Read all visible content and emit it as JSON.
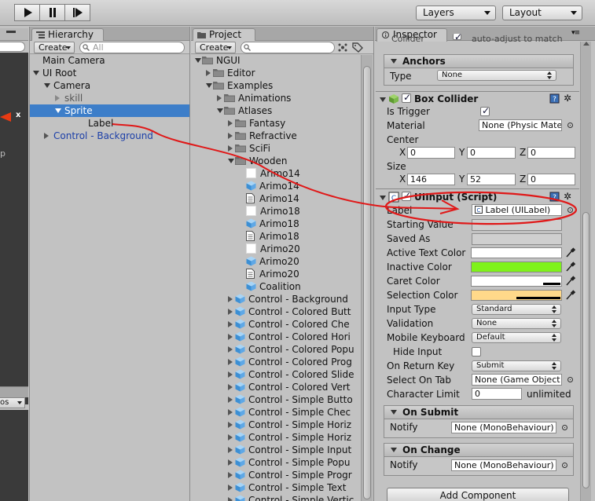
{
  "toolbar": {
    "play": "play-icon",
    "pause": "pause-icon",
    "step": "step-icon",
    "layers": "Layers",
    "layout": "Layout"
  },
  "scene_fragments": {
    "axis_x": "x",
    "side_letter": "p",
    "gizmos": "os"
  },
  "hierarchy": {
    "tab": "Hierarchy",
    "create": "Create",
    "search_placeholder": "All",
    "items": [
      {
        "label": "Main Camera",
        "indent": 0,
        "fold": "none"
      },
      {
        "label": "UI Root",
        "indent": 0,
        "fold": "down"
      },
      {
        "label": "Camera",
        "indent": 1,
        "fold": "down"
      },
      {
        "label": "skill",
        "indent": 2,
        "fold": "right-gray"
      },
      {
        "label": "Sprite",
        "indent": 2,
        "fold": "down",
        "selected": true
      },
      {
        "label": "Label",
        "indent": 3,
        "fold": "none"
      },
      {
        "label": "Control - Background",
        "indent": 1,
        "fold": "right",
        "link": true
      }
    ]
  },
  "project": {
    "tab": "Project",
    "create": "Create",
    "items": [
      {
        "label": "NGUI",
        "icon": "folder",
        "indent": 0,
        "fold": "down"
      },
      {
        "label": "Editor",
        "icon": "folder",
        "indent": 1,
        "fold": "right"
      },
      {
        "label": "Examples",
        "icon": "folder",
        "indent": 1,
        "fold": "down"
      },
      {
        "label": "Animations",
        "icon": "folder",
        "indent": 2,
        "fold": "right"
      },
      {
        "label": "Atlases",
        "icon": "folder",
        "indent": 2,
        "fold": "down"
      },
      {
        "label": "Fantasy",
        "icon": "folder",
        "indent": 3,
        "fold": "right"
      },
      {
        "label": "Refractive",
        "icon": "folder",
        "indent": 3,
        "fold": "right"
      },
      {
        "label": "SciFi",
        "icon": "folder",
        "indent": 3,
        "fold": "right"
      },
      {
        "label": "Wooden",
        "icon": "folder",
        "indent": 3,
        "fold": "down"
      },
      {
        "label": "Arimo14",
        "icon": "white",
        "indent": 4,
        "fold": "none"
      },
      {
        "label": "Arimo14",
        "icon": "cube",
        "indent": 4,
        "fold": "none"
      },
      {
        "label": "Arimo14",
        "icon": "doc",
        "indent": 4,
        "fold": "none"
      },
      {
        "label": "Arimo18",
        "icon": "white",
        "indent": 4,
        "fold": "none"
      },
      {
        "label": "Arimo18",
        "icon": "cube",
        "indent": 4,
        "fold": "none"
      },
      {
        "label": "Arimo18",
        "icon": "doc",
        "indent": 4,
        "fold": "none"
      },
      {
        "label": "Arimo20",
        "icon": "white",
        "indent": 4,
        "fold": "none"
      },
      {
        "label": "Arimo20",
        "icon": "cube",
        "indent": 4,
        "fold": "none"
      },
      {
        "label": "Arimo20",
        "icon": "doc",
        "indent": 4,
        "fold": "none"
      },
      {
        "label": "Coalition",
        "icon": "cube",
        "indent": 4,
        "fold": "none"
      },
      {
        "label": "Control - Background",
        "icon": "cube",
        "indent": 3,
        "fold": "right"
      },
      {
        "label": "Control - Colored Butt",
        "icon": "cube",
        "indent": 3,
        "fold": "right"
      },
      {
        "label": "Control - Colored Che",
        "icon": "cube",
        "indent": 3,
        "fold": "right"
      },
      {
        "label": "Control - Colored Hori",
        "icon": "cube",
        "indent": 3,
        "fold": "right"
      },
      {
        "label": "Control - Colored Popu",
        "icon": "cube",
        "indent": 3,
        "fold": "right"
      },
      {
        "label": "Control - Colored Prog",
        "icon": "cube",
        "indent": 3,
        "fold": "right"
      },
      {
        "label": "Control - Colored Slide",
        "icon": "cube",
        "indent": 3,
        "fold": "right"
      },
      {
        "label": "Control - Colored Vert",
        "icon": "cube",
        "indent": 3,
        "fold": "right"
      },
      {
        "label": "Control - Simple Butto",
        "icon": "cube",
        "indent": 3,
        "fold": "right"
      },
      {
        "label": "Control - Simple Chec",
        "icon": "cube",
        "indent": 3,
        "fold": "right"
      },
      {
        "label": "Control - Simple Horiz",
        "icon": "cube",
        "indent": 3,
        "fold": "right"
      },
      {
        "label": "Control - Simple Horiz",
        "icon": "cube",
        "indent": 3,
        "fold": "right"
      },
      {
        "label": "Control - Simple Input",
        "icon": "cube",
        "indent": 3,
        "fold": "right"
      },
      {
        "label": "Control - Simple Popu",
        "icon": "cube",
        "indent": 3,
        "fold": "right"
      },
      {
        "label": "Control - Simple Progr",
        "icon": "cube",
        "indent": 3,
        "fold": "right"
      },
      {
        "label": "Control - Simple Text",
        "icon": "cube",
        "indent": 3,
        "fold": "right"
      },
      {
        "label": "Control - Simple Vertic",
        "icon": "cube",
        "indent": 3,
        "fold": "right"
      }
    ]
  },
  "inspector": {
    "tab": "Inspector",
    "top_partial": {
      "label": "Collider",
      "value": "auto-adjust to match"
    },
    "anchors": {
      "title": "Anchors",
      "type_label": "Type",
      "type_value": "None"
    },
    "box_collider": {
      "title": "Box Collider",
      "is_trigger_label": "Is Trigger",
      "material_label": "Material",
      "material_value": "None (Physic Mate",
      "center_label": "Center",
      "center": {
        "x": "0",
        "y": "0",
        "z": "0"
      },
      "size_label": "Size",
      "size": {
        "x": "146",
        "y": "52",
        "z": "0"
      },
      "axes": {
        "x": "X",
        "y": "Y",
        "z": "Z"
      }
    },
    "uiinput": {
      "title": "UIInput (Script)",
      "label_label": "Label",
      "label_value": "Label (UILabel)",
      "starting_value_label": "Starting Value",
      "saved_as_label": "Saved As",
      "active_text_color_label": "Active Text Color",
      "inactive_color_label": "Inactive Color",
      "caret_color_label": "Caret Color",
      "selection_color_label": "Selection Color",
      "input_type_label": "Input Type",
      "input_type_value": "Standard",
      "validation_label": "Validation",
      "validation_value": "None",
      "mobile_keyboard_label": "Mobile Keyboard",
      "mobile_keyboard_value": "Default",
      "hide_input_label": "Hide Input",
      "on_return_key_label": "On Return Key",
      "on_return_key_value": "Submit",
      "select_on_tab_label": "Select On Tab",
      "select_on_tab_value": "None (Game Object",
      "character_limit_label": "Character Limit",
      "character_limit_value": "0",
      "unlimited": "unlimited"
    },
    "on_submit": {
      "title": "On Submit",
      "notify_label": "Notify",
      "notify_value": "None (MonoBehaviour)"
    },
    "on_change": {
      "title": "On Change",
      "notify_label": "Notify",
      "notify_value": "None (MonoBehaviour)"
    },
    "add_component": "Add Component"
  },
  "colors": {
    "active_text": "#ffffff",
    "inactive": "#7ff21a",
    "caret": "#ffffff",
    "selection": "#ffd98a",
    "annotation": "#e01818",
    "selection_row": "#3d7ec9"
  }
}
